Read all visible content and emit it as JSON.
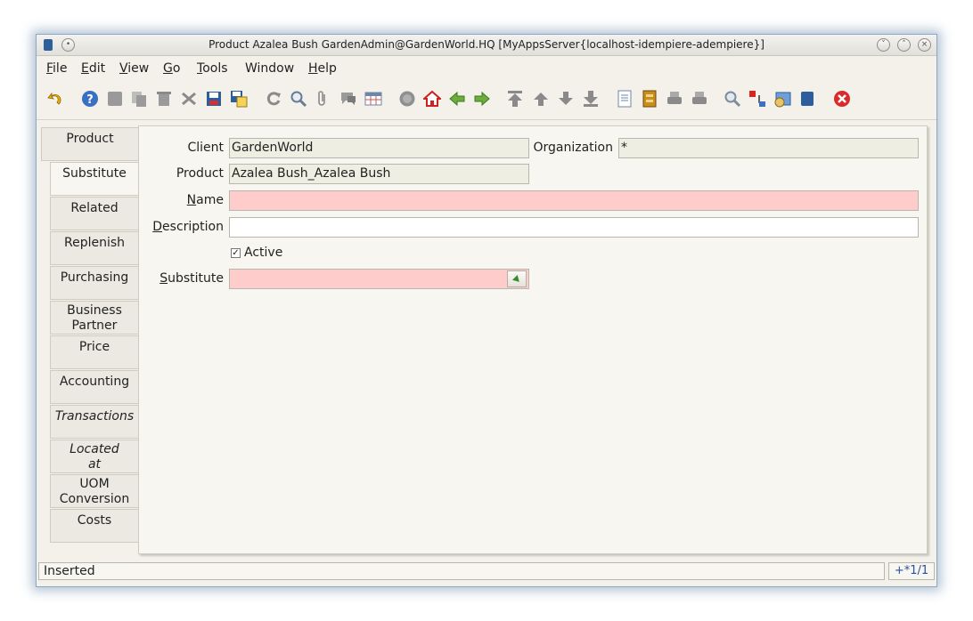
{
  "window": {
    "title": "Product  Azalea Bush  GardenAdmin@GardenWorld.HQ [MyAppsServer{localhost-idempiere-adempiere}]"
  },
  "menu": {
    "file": {
      "u": "F",
      "rest": "ile"
    },
    "edit": {
      "u": "E",
      "rest": "dit"
    },
    "view": {
      "u": "V",
      "rest": "iew"
    },
    "go": {
      "u": "G",
      "rest": "o"
    },
    "tools": {
      "u": "T",
      "rest": "ools"
    },
    "window": {
      "label": "Window"
    },
    "help": {
      "u": "H",
      "rest": "elp"
    }
  },
  "tabs": [
    {
      "label": "Product"
    },
    {
      "label": "Substitute"
    },
    {
      "label": "Related"
    },
    {
      "label": "Replenish"
    },
    {
      "label": "Purchasing"
    },
    {
      "label": "Business Partner"
    },
    {
      "label": "Price"
    },
    {
      "label": "Accounting"
    },
    {
      "label": "Transactions"
    },
    {
      "label": "Located at"
    },
    {
      "label": "UOM Conversion"
    },
    {
      "label": "Costs"
    }
  ],
  "form": {
    "client_label": "Client",
    "client_value": "GardenWorld",
    "org_label": "Organization",
    "org_value": "*",
    "product_label": "Product",
    "product_value": "Azalea Bush_Azalea Bush",
    "name_label_u": "N",
    "name_label_rest": "ame",
    "name_value": "",
    "description_label_u": "D",
    "description_label_rest": "escription",
    "description_value": "",
    "active_label": "Active",
    "active_checked": "✓",
    "substitute_label_u": "S",
    "substitute_label_rest": "ubstitute",
    "substitute_value": ""
  },
  "status": {
    "message": "Inserted",
    "record": "+*1/1"
  },
  "colors": {
    "required_field": "#ffcccc",
    "readonly_field": "#efeee3",
    "record_indicator": "#2a4fa0"
  },
  "icons": {
    "undo": "undo-icon",
    "help": "help-icon",
    "new": "new-record-icon",
    "copy": "copy-record-icon",
    "delete": "delete-record-icon",
    "delete_selection": "delete-selection-icon",
    "save": "save-icon",
    "save_new": "save-and-new-icon",
    "refresh": "refresh-icon",
    "find": "find-icon",
    "attachment": "attachment-icon",
    "chat": "chat-icon",
    "grid": "grid-toggle-icon",
    "history": "history-icon",
    "home": "home-icon",
    "parent": "parent-record-icon",
    "detail": "detail-record-icon",
    "first": "first-record-icon",
    "previous": "previous-record-icon",
    "next": "next-record-icon",
    "last": "last-record-icon",
    "report": "report-icon",
    "archive": "archive-icon",
    "print_preview": "print-preview-icon",
    "print": "print-icon",
    "zoom_across": "zoom-across-icon",
    "request": "request-icon",
    "product_info": "product-info-icon",
    "workflow": "workflow-icon",
    "end": "close-window-icon"
  }
}
